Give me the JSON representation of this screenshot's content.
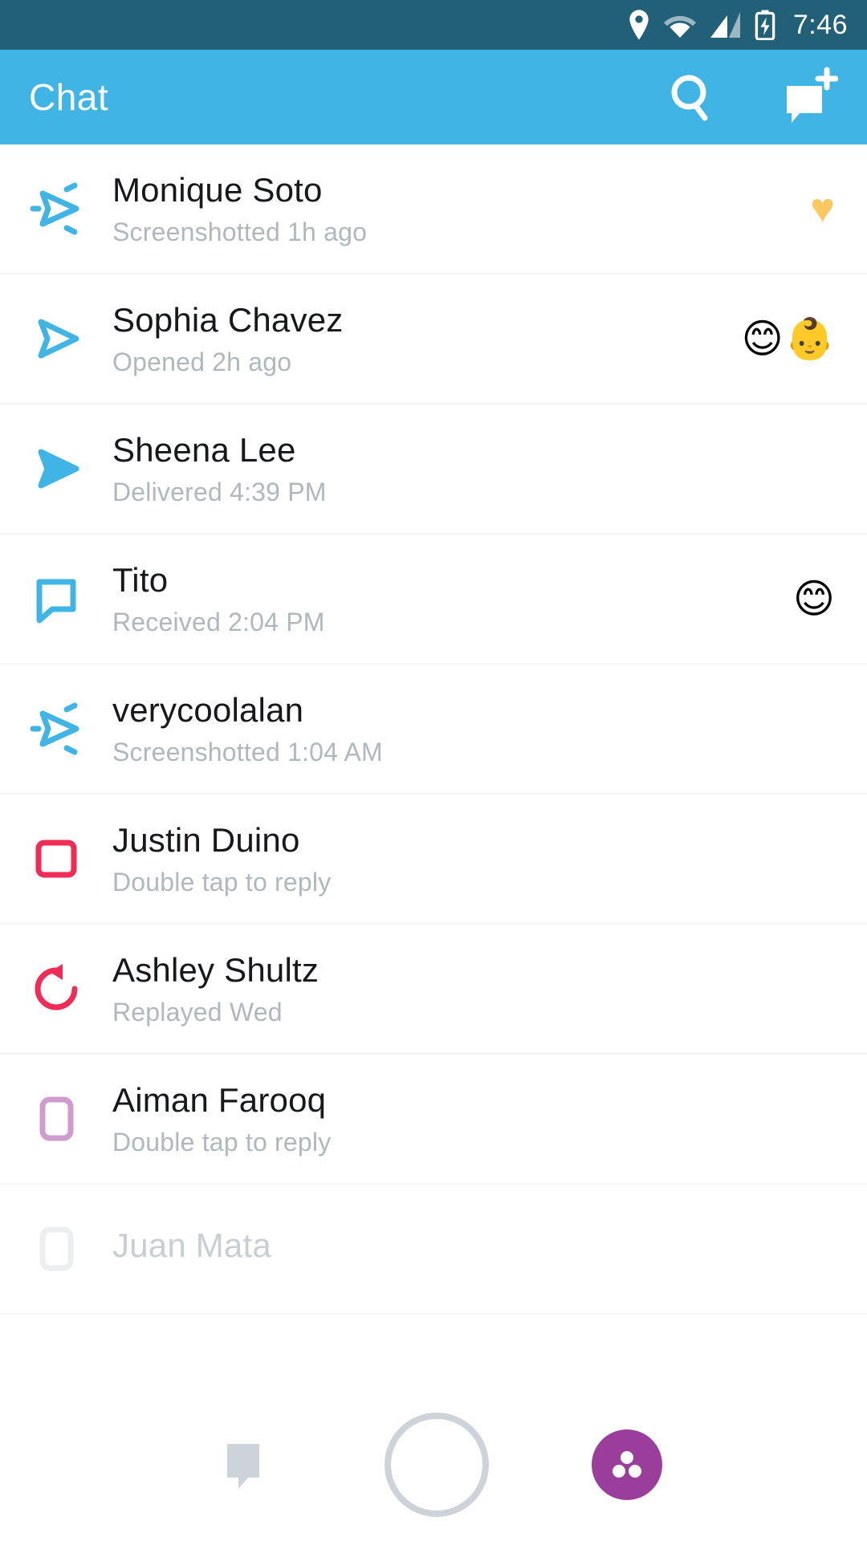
{
  "status_bar": {
    "time": "7:46",
    "icons": [
      "location-pin-icon",
      "wifi-icon",
      "signal-bars-icon",
      "battery-charging-icon"
    ],
    "background_color": "#226078"
  },
  "header": {
    "title": "Chat",
    "accent_color": "#3fb4e5",
    "search_icon": "search-icon",
    "new_chat_icon": "new-chat-icon"
  },
  "chats": [
    {
      "name": "Monique Soto",
      "status": "Screenshotted 1h ago",
      "icon": "screenshotted-snap-icon",
      "icon_color": "#3fb4e5",
      "reactions": [
        "yellow-heart"
      ]
    },
    {
      "name": "Sophia Chavez",
      "status": "Opened 2h ago",
      "icon": "opened-snap-icon",
      "icon_color": "#3fb4e5",
      "reactions": [
        "smiling-face-blush",
        "baby-face"
      ]
    },
    {
      "name": "Sheena Lee",
      "status": "Delivered 4:39 PM",
      "icon": "delivered-snap-icon",
      "icon_color": "#3fb4e5",
      "reactions": []
    },
    {
      "name": "Tito",
      "status": "Received 2:04 PM",
      "icon": "received-chat-icon",
      "icon_color": "#3fb4e5",
      "reactions": [
        "smiling-face-blush"
      ]
    },
    {
      "name": "verycoolalan",
      "status": "Screenshotted 1:04 AM",
      "icon": "screenshotted-snap-icon",
      "icon_color": "#3fb4e5",
      "reactions": []
    },
    {
      "name": "Justin Duino",
      "status": "Double tap to reply",
      "icon": "new-snap-icon",
      "icon_color": "#ef2b56",
      "reactions": []
    },
    {
      "name": "Ashley Shultz",
      "status": "Replayed Wed",
      "icon": "replayed-snap-icon",
      "icon_color": "#ef2b56",
      "reactions": []
    },
    {
      "name": "Aiman Farooq",
      "status": "Double tap to reply",
      "icon": "new-snap-icon",
      "icon_color": "#d09cce",
      "reactions": []
    },
    {
      "name": "Juan Mata",
      "status": "",
      "icon": "new-snap-icon",
      "icon_color": "#eceef0",
      "reactions": []
    }
  ],
  "bottom_nav": {
    "chat_icon": "chat-bubble-icon",
    "camera_shutter": "camera-shutter-button",
    "stories_icon": "stories-icon",
    "stories_color": "#9b3d9b"
  }
}
